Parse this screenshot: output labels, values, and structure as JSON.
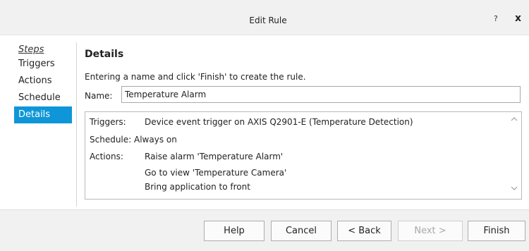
{
  "window": {
    "title": "Edit Rule",
    "help_glyph": "?",
    "close_glyph": "x"
  },
  "steps": {
    "header": "Steps",
    "items": [
      {
        "label": "Triggers",
        "active": false
      },
      {
        "label": "Actions",
        "active": false
      },
      {
        "label": "Schedule",
        "active": false
      },
      {
        "label": "Details",
        "active": true
      }
    ]
  },
  "details": {
    "title": "Details",
    "instruction": "Entering a name and click 'Finish' to create the rule.",
    "name_label": "Name:",
    "name_value": "Temperature Alarm",
    "summary": {
      "triggers_label": "Triggers:",
      "triggers_value": "Device event trigger on AXIS Q2901-E (Temperature Detection)",
      "schedule_text": "Schedule: Always on",
      "actions_label": "Actions:",
      "actions": [
        "Raise alarm 'Temperature Alarm'",
        "Go to view 'Temperature Camera'",
        "Bring application to front"
      ]
    }
  },
  "buttons": {
    "help": "Help",
    "cancel": "Cancel",
    "back": "< Back",
    "next": "Next >",
    "finish": "Finish"
  },
  "colors": {
    "accent": "#0f96d8",
    "titlebar_bg": "#f1f1f1"
  },
  "icons": {
    "scroll_up": "scroll-up-arrow-icon",
    "scroll_down": "scroll-down-arrow-icon"
  }
}
